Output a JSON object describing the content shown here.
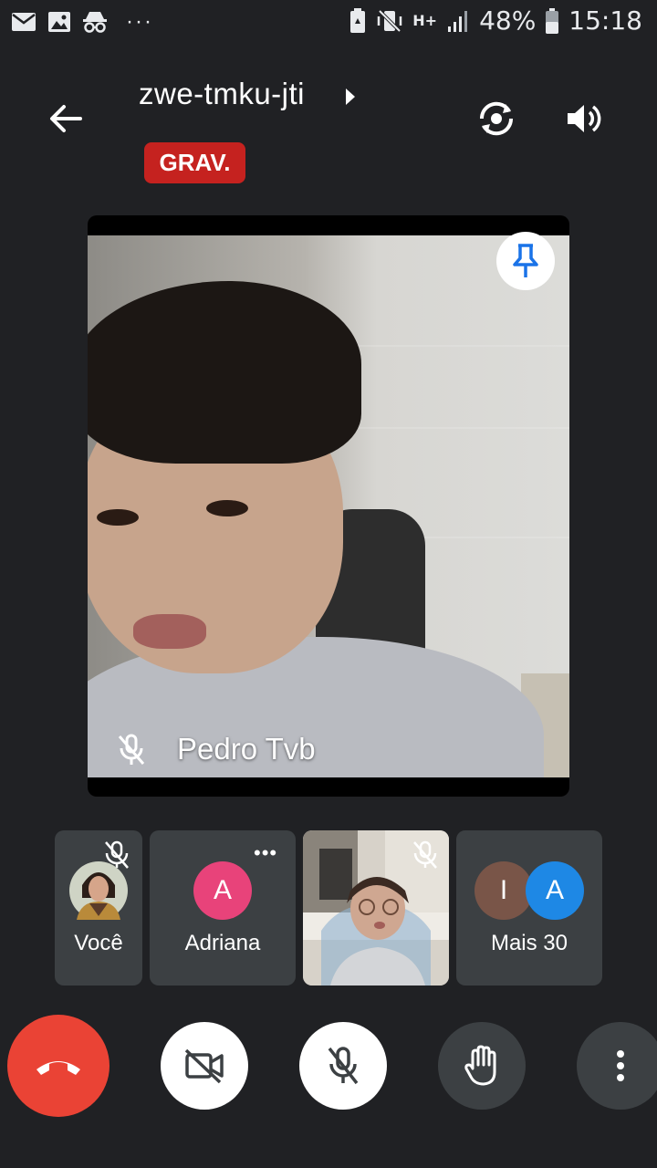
{
  "status_bar": {
    "battery_percent": "48%",
    "time": "15:18",
    "network": "H+",
    "more": "···"
  },
  "header": {
    "meeting_code": "zwe-tmku-jti",
    "recording_badge": "GRAV."
  },
  "main_tile": {
    "participant_name": "Pedro Tvb"
  },
  "participants": {
    "self_label": "Você",
    "adriana_initial": "A",
    "adriana_label": "Adriana",
    "adriana_menu": "•••",
    "more_avatar_1": "I",
    "more_avatar_2": "A",
    "more_label": "Mais 30"
  },
  "colors": {
    "background": "#202124",
    "record_red": "#c5221f",
    "end_call_red": "#ea4335",
    "tile_gray": "#3c4043",
    "adriana_pink": "#e8437a",
    "avatar_brown": "#795548",
    "avatar_blue": "#1e88e5",
    "pin_blue": "#1a73e8"
  }
}
